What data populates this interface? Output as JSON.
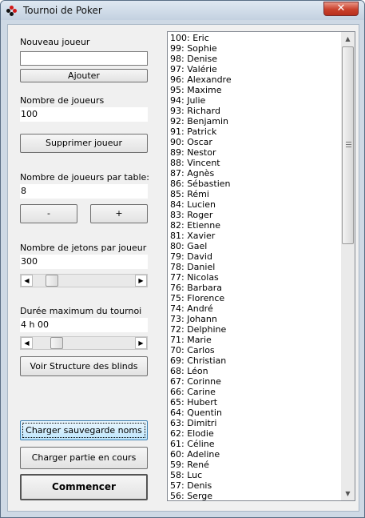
{
  "window": {
    "title": "Tournoi de Poker",
    "close_glyph": "✕"
  },
  "new_player": {
    "label": "Nouveau joueur",
    "value": "",
    "add_button": "Ajouter"
  },
  "player_count": {
    "label": "Nombre de joueurs",
    "value": "100",
    "delete_button": "Supprimer joueur"
  },
  "players_per_table": {
    "label": "Nombre de joueurs par table:",
    "value": "8",
    "minus_button": "-",
    "plus_button": "+"
  },
  "chips_per_player": {
    "label": "Nombre de jetons par joueur",
    "value": "300",
    "slider_level": 0.14
  },
  "max_duration": {
    "label": "Durée maximum du tournoi",
    "value": "4 h 00",
    "slider_level": 0.2
  },
  "blinds_button": "Voir Structure des blinds",
  "bottom_buttons": {
    "load_names": "Charger sauvegarde noms",
    "load_game": "Charger partie en cours",
    "start": "Commencer"
  },
  "scroll": {
    "left_glyph": "◀",
    "right_glyph": "▶",
    "up_glyph": "▲",
    "down_glyph": "▼"
  },
  "players": [
    "100: Eric",
    "99: Sophie",
    "98: Denise",
    "97: Valérie",
    "96: Alexandre",
    "95: Maxime",
    "94: Julie",
    "93: Richard",
    "92: Benjamin",
    "91: Patrick",
    "90: Oscar",
    "89: Nestor",
    "88: Vincent",
    "87: Agnès",
    "86: Sébastien",
    "85: Rémi",
    "84: Lucien",
    "83: Roger",
    "82: Etienne",
    "81: Xavier",
    "80: Gael",
    "79: David",
    "78: Daniel",
    "77: Nicolas",
    "76: Barbara",
    "75: Florence",
    "74: André",
    "73: Johann",
    "72: Delphine",
    "71: Marie",
    "70: Carlos",
    "69: Christian",
    "68: Léon",
    "67: Corinne",
    "66: Carine",
    "65: Hubert",
    "64: Quentin",
    "63: Dimitri",
    "62: Elodie",
    "61: Céline",
    "60: Adeline",
    "59: René",
    "58: Luc",
    "57: Denis",
    "56: Serge"
  ]
}
